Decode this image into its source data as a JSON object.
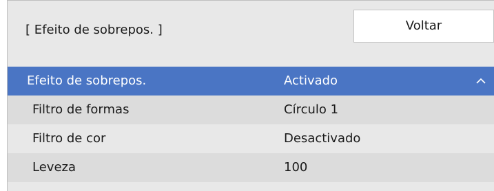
{
  "header": {
    "title": "[ Efeito de sobrepos. ]",
    "back_label": "Voltar"
  },
  "settings": [
    {
      "label": "Efeito de sobrepos.",
      "value": "Activado",
      "selected": true,
      "icon": "chevron-up-icon"
    },
    {
      "label": "Filtro de formas",
      "value": "Círculo 1"
    },
    {
      "label": "Filtro de cor",
      "value": "Desactivado"
    },
    {
      "label": "Leveza",
      "value": "100"
    }
  ],
  "colors": {
    "selection": "#4a75c4",
    "panel_bg": "#e8e8e8",
    "alt_row_bg": "#dcdcdc"
  }
}
